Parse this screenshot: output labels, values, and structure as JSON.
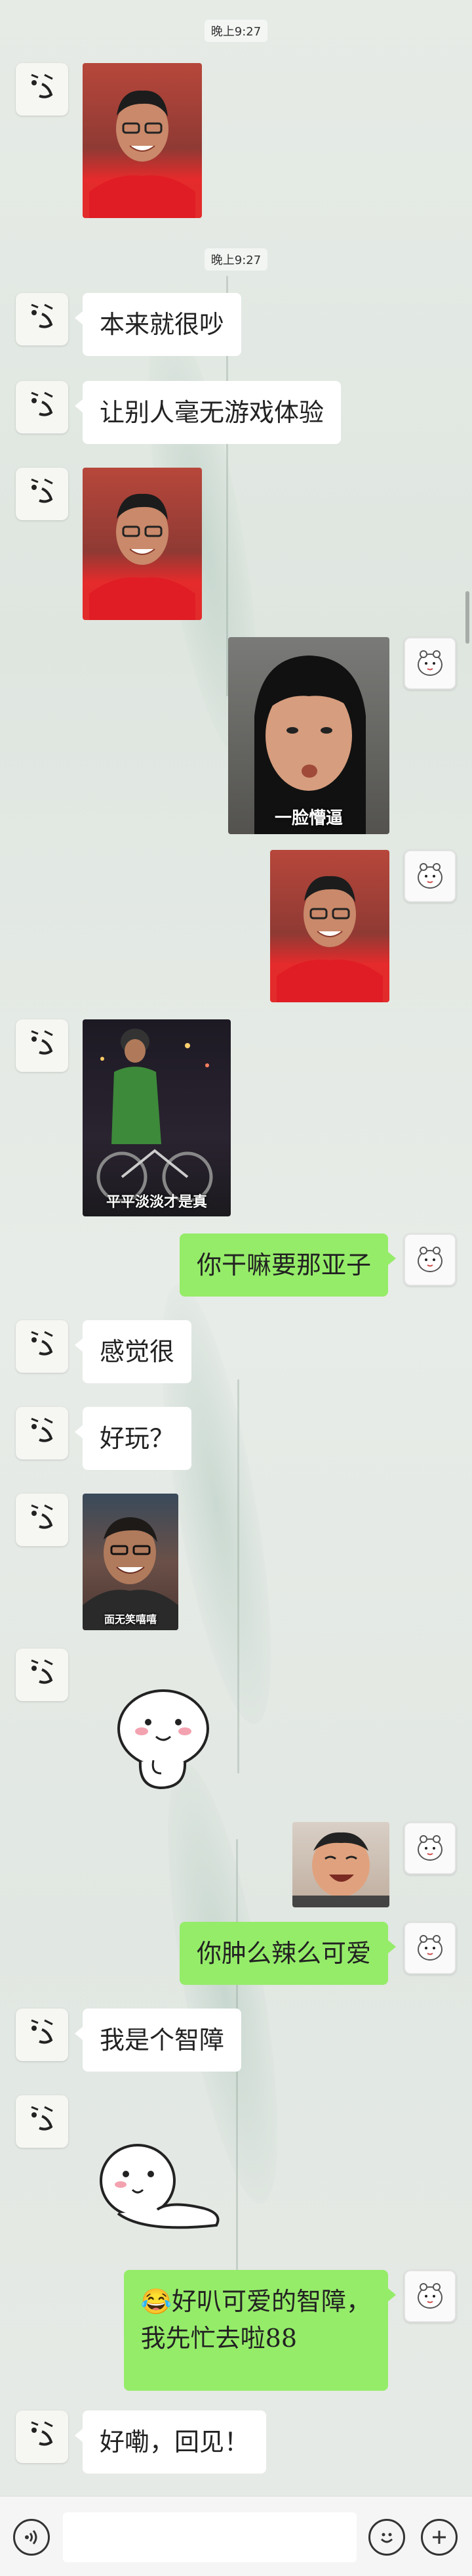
{
  "timestamps": [
    "晚上9:27",
    "晚上9:27"
  ],
  "messages": {
    "m2": "本来就很吵",
    "m3": "让别人毫无游戏体验",
    "m8": "你干嘛要那亚子",
    "m9": "感觉很",
    "m10": "好玩？",
    "m14": "你肿么辣么可爱",
    "m15": "我是个智障",
    "m17": "😂好叭可爱的智障，\n我先忙去啦88",
    "m18": "好嘞，回见！"
  },
  "captions": {
    "m5": "一脸懵逼",
    "m7": "平平淡淡才是真",
    "m11": "面无笑嘻嘻"
  },
  "input": {
    "placeholder": "",
    "value": ""
  },
  "icons": {
    "voice": "voice-icon",
    "emoji": "emoji-icon",
    "plus": "plus-icon",
    "avatar_friend": "sticker-face-avatar",
    "avatar_me": "cartoon-bear-avatar"
  },
  "colors": {
    "my_bubble": "#95ec69",
    "friend_bubble": "#ffffff",
    "background": "#e3e9e4"
  }
}
